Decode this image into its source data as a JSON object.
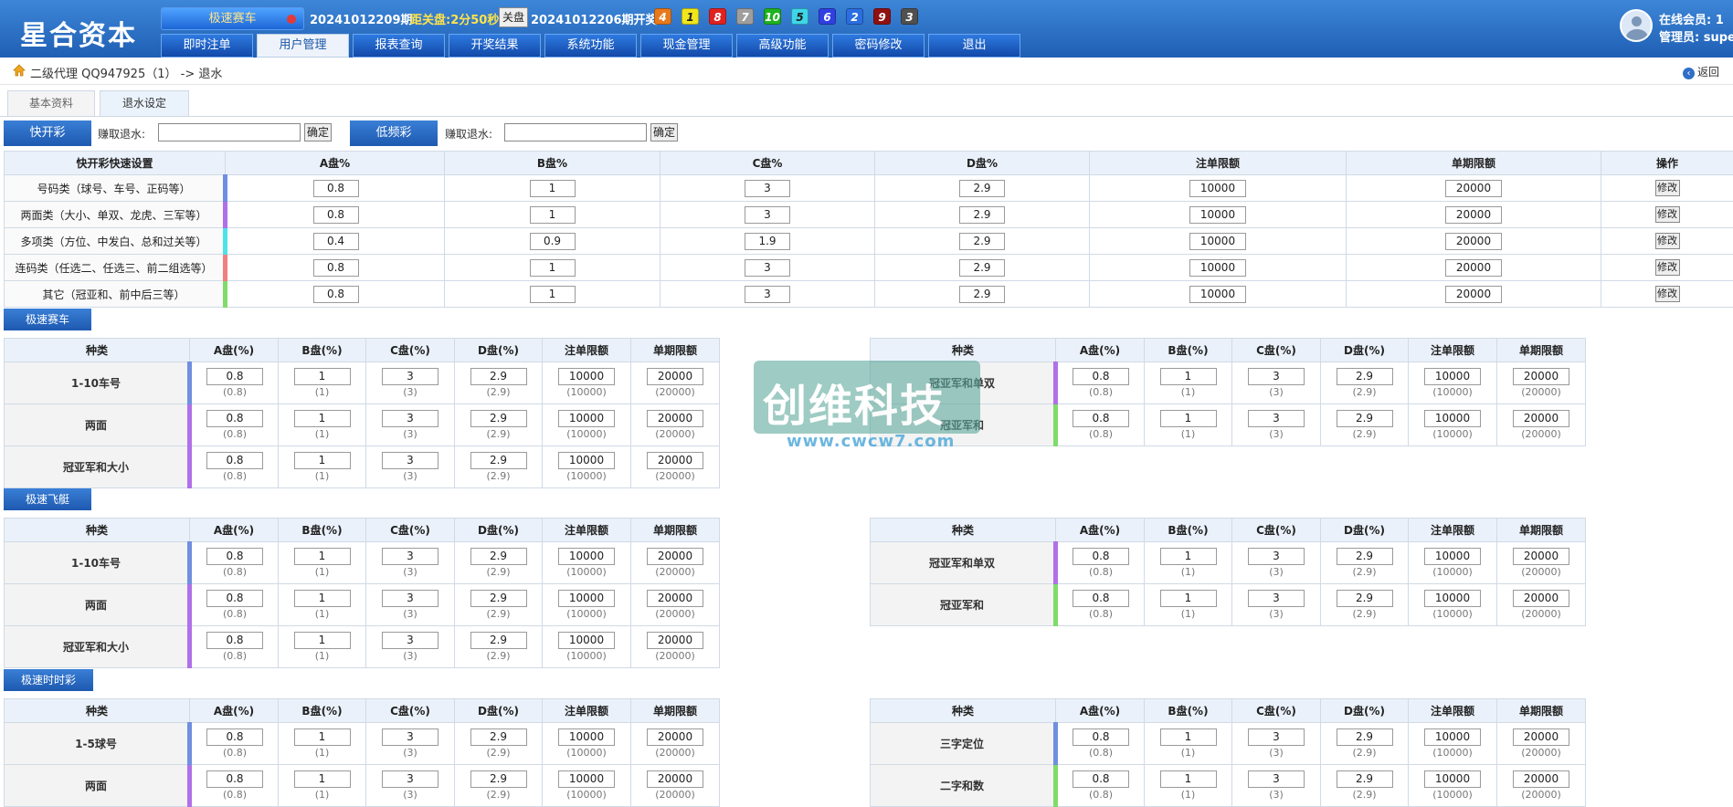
{
  "header": {
    "logo": "星合资本",
    "lottery_select": "极速赛车",
    "period_current": "20241012209期",
    "countdown": "距关盘:2分50秒",
    "close_label": "关盘",
    "period_last": "20241012206期开奖:",
    "balls": [
      {
        "n": "4",
        "color": "#e8791b"
      },
      {
        "n": "1",
        "color": "#f1e61b"
      },
      {
        "n": "8",
        "color": "#e0221f"
      },
      {
        "n": "7",
        "color": "#9e9e9e"
      },
      {
        "n": "10",
        "color": "#1fb21f"
      },
      {
        "n": "5",
        "color": "#3fd6e8"
      },
      {
        "n": "6",
        "color": "#3040e0"
      },
      {
        "n": "2",
        "color": "#2b6ee0"
      },
      {
        "n": "9",
        "color": "#901010"
      },
      {
        "n": "3",
        "color": "#505050"
      }
    ],
    "online_label": "在线会员: 1",
    "admin_label": "管理员: super"
  },
  "nav": [
    "即时注单",
    "用户管理",
    "报表查询",
    "开奖结果",
    "系统功能",
    "现金管理",
    "高级功能",
    "密码修改",
    "退出"
  ],
  "nav_active": 1,
  "breadcrumb": "二级代理 QQ947925（1） -> 退水",
  "back_label": "返回",
  "tabs": [
    "基本资料",
    "退水设定"
  ],
  "rebate": {
    "fast_btn": "快开彩",
    "slow_btn": "低频彩",
    "earn_label": "赚取退水:",
    "ok_label": "确定"
  },
  "quick": {
    "headers": [
      "快开彩快速设置",
      "A盘%",
      "B盘%",
      "C盘%",
      "D盘%",
      "注单限额",
      "单期限额",
      "操作"
    ],
    "rows": [
      {
        "label": "号码类（球号、车号、正码等）",
        "color": "#6f8fe0",
        "a": "0.8",
        "b": "1",
        "c": "3",
        "d": "2.9",
        "bet": "10000",
        "period": "20000",
        "op": "修改"
      },
      {
        "label": "两面类（大小、单双、龙虎、三军等）",
        "color": "#b070e8",
        "a": "0.8",
        "b": "1",
        "c": "3",
        "d": "2.9",
        "bet": "10000",
        "period": "20000",
        "op": "修改"
      },
      {
        "label": "多项类（方位、中发白、总和过关等）",
        "color": "#4ee3e8",
        "a": "0.4",
        "b": "0.9",
        "c": "1.9",
        "d": "2.9",
        "bet": "10000",
        "period": "20000",
        "op": "修改"
      },
      {
        "label": "连码类（任选二、任选三、前二组选等）",
        "color": "#f07f7f",
        "a": "0.8",
        "b": "1",
        "c": "3",
        "d": "2.9",
        "bet": "10000",
        "period": "20000",
        "op": "修改"
      },
      {
        "label": "其它（冠亚和、前中后三等）",
        "color": "#7fdc6a",
        "a": "0.8",
        "b": "1",
        "c": "3",
        "d": "2.9",
        "bet": "10000",
        "period": "20000",
        "op": "修改"
      }
    ]
  },
  "detail_headers": [
    "种类",
    "A盘(%)",
    "B盘(%)",
    "C盘(%)",
    "D盘(%)",
    "注单限额",
    "单期限额"
  ],
  "sections": [
    {
      "title": "极速赛车",
      "left": [
        {
          "kind": "1-10车号",
          "color": "#6f8fe0",
          "vals": [
            "0.8",
            "1",
            "3",
            "2.9",
            "10000",
            "20000"
          ],
          "subs": [
            "(0.8)",
            "(1)",
            "(3)",
            "(2.9)",
            "(10000)",
            "(20000)"
          ]
        },
        {
          "kind": "两面",
          "color": "#b070e8",
          "vals": [
            "0.8",
            "1",
            "3",
            "2.9",
            "10000",
            "20000"
          ],
          "subs": [
            "(0.8)",
            "(1)",
            "(3)",
            "(2.9)",
            "(10000)",
            "(20000)"
          ]
        },
        {
          "kind": "冠亚军和大小",
          "color": "#b070e8",
          "vals": [
            "0.8",
            "1",
            "3",
            "2.9",
            "10000",
            "20000"
          ],
          "subs": [
            "(0.8)",
            "(1)",
            "(3)",
            "(2.9)",
            "(10000)",
            "(20000)"
          ]
        }
      ],
      "right": [
        {
          "kind": "冠亚军和单双",
          "color": "#b070e8",
          "vals": [
            "0.8",
            "1",
            "3",
            "2.9",
            "10000",
            "20000"
          ],
          "subs": [
            "(0.8)",
            "(1)",
            "(3)",
            "(2.9)",
            "(10000)",
            "(20000)"
          ]
        },
        {
          "kind": "冠亚军和",
          "color": "#7fdc6a",
          "vals": [
            "0.8",
            "1",
            "3",
            "2.9",
            "10000",
            "20000"
          ],
          "subs": [
            "(0.8)",
            "(1)",
            "(3)",
            "(2.9)",
            "(10000)",
            "(20000)"
          ]
        }
      ]
    },
    {
      "title": "极速飞艇",
      "left": [
        {
          "kind": "1-10车号",
          "color": "#6f8fe0",
          "vals": [
            "0.8",
            "1",
            "3",
            "2.9",
            "10000",
            "20000"
          ],
          "subs": [
            "(0.8)",
            "(1)",
            "(3)",
            "(2.9)",
            "(10000)",
            "(20000)"
          ]
        },
        {
          "kind": "两面",
          "color": "#b070e8",
          "vals": [
            "0.8",
            "1",
            "3",
            "2.9",
            "10000",
            "20000"
          ],
          "subs": [
            "(0.8)",
            "(1)",
            "(3)",
            "(2.9)",
            "(10000)",
            "(20000)"
          ]
        },
        {
          "kind": "冠亚军和大小",
          "color": "#b070e8",
          "vals": [
            "0.8",
            "1",
            "3",
            "2.9",
            "10000",
            "20000"
          ],
          "subs": [
            "(0.8)",
            "(1)",
            "(3)",
            "(2.9)",
            "(10000)",
            "(20000)"
          ]
        }
      ],
      "right": [
        {
          "kind": "冠亚军和单双",
          "color": "#b070e8",
          "vals": [
            "0.8",
            "1",
            "3",
            "2.9",
            "10000",
            "20000"
          ],
          "subs": [
            "(0.8)",
            "(1)",
            "(3)",
            "(2.9)",
            "(10000)",
            "(20000)"
          ]
        },
        {
          "kind": "冠亚军和",
          "color": "#7fdc6a",
          "vals": [
            "0.8",
            "1",
            "3",
            "2.9",
            "10000",
            "20000"
          ],
          "subs": [
            "(0.8)",
            "(1)",
            "(3)",
            "(2.9)",
            "(10000)",
            "(20000)"
          ]
        }
      ]
    },
    {
      "title": "极速时时彩",
      "left": [
        {
          "kind": "1-5球号",
          "color": "#6f8fe0",
          "vals": [
            "0.8",
            "1",
            "3",
            "2.9",
            "10000",
            "20000"
          ],
          "subs": [
            "(0.8)",
            "(1)",
            "(3)",
            "(2.9)",
            "(10000)",
            "(20000)"
          ]
        },
        {
          "kind": "两面",
          "color": "#b070e8",
          "vals": [
            "0.8",
            "1",
            "3",
            "2.9",
            "10000",
            "20000"
          ],
          "subs": [
            "(0.8)",
            "(1)",
            "(3)",
            "(2.9)",
            "(10000)",
            "(20000)"
          ]
        }
      ],
      "right": [
        {
          "kind": "三字定位",
          "color": "#6f8fe0",
          "vals": [
            "0.8",
            "1",
            "3",
            "2.9",
            "10000",
            "20000"
          ],
          "subs": [
            "(0.8)",
            "(1)",
            "(3)",
            "(2.9)",
            "(10000)",
            "(20000)"
          ]
        },
        {
          "kind": "二字和数",
          "color": "#7fdc6a",
          "vals": [
            "0.8",
            "1",
            "3",
            "2.9",
            "10000",
            "20000"
          ],
          "subs": [
            "(0.8)",
            "(1)",
            "(3)",
            "(2.9)",
            "(10000)",
            "(20000)"
          ]
        }
      ]
    }
  ],
  "watermark": {
    "title": "创维科技",
    "url": "www.cwcw7.com"
  }
}
